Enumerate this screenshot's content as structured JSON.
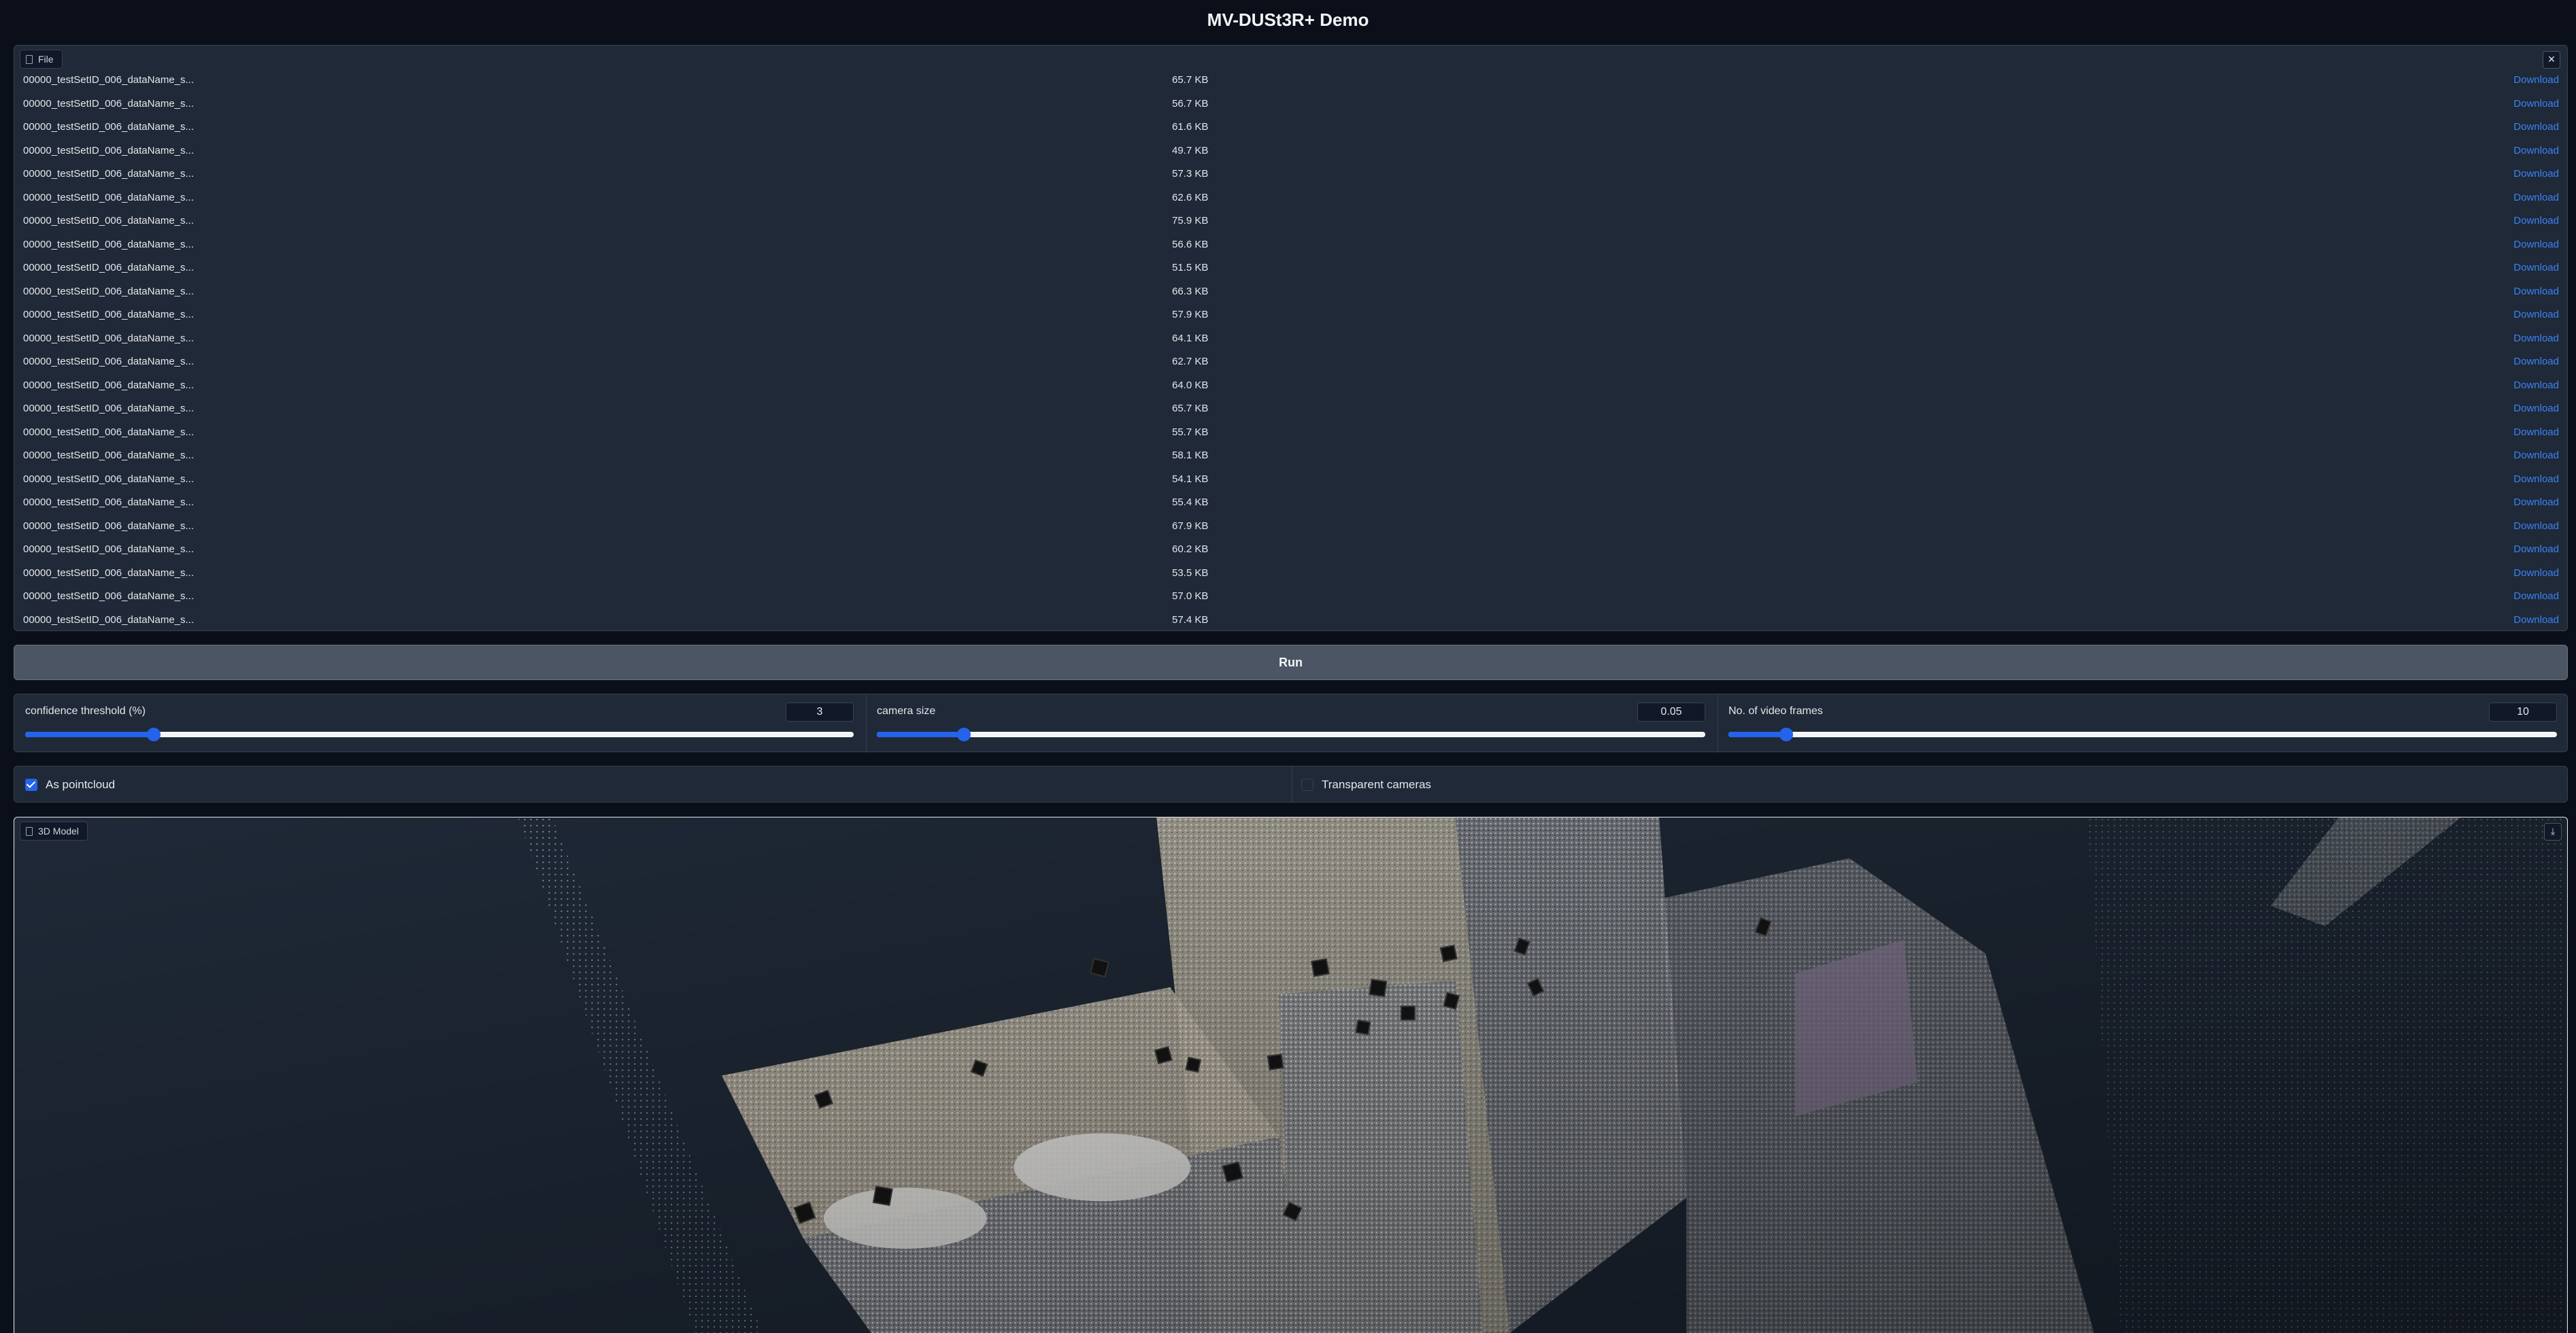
{
  "app": {
    "title": "MV-DUSt3R+ Demo"
  },
  "file_block": {
    "label": "File",
    "close_glyph": "×",
    "download_label": "Download",
    "files": [
      {
        "name": "00000_testSetID_006_dataName_s...",
        "size": "65.7 KB"
      },
      {
        "name": "00000_testSetID_006_dataName_s...",
        "size": "56.7 KB"
      },
      {
        "name": "00000_testSetID_006_dataName_s...",
        "size": "61.6 KB"
      },
      {
        "name": "00000_testSetID_006_dataName_s...",
        "size": "49.7 KB"
      },
      {
        "name": "00000_testSetID_006_dataName_s...",
        "size": "57.3 KB"
      },
      {
        "name": "00000_testSetID_006_dataName_s...",
        "size": "62.6 KB"
      },
      {
        "name": "00000_testSetID_006_dataName_s...",
        "size": "75.9 KB"
      },
      {
        "name": "00000_testSetID_006_dataName_s...",
        "size": "56.6 KB"
      },
      {
        "name": "00000_testSetID_006_dataName_s...",
        "size": "51.5 KB"
      },
      {
        "name": "00000_testSetID_006_dataName_s...",
        "size": "66.3 KB"
      },
      {
        "name": "00000_testSetID_006_dataName_s...",
        "size": "57.9 KB"
      },
      {
        "name": "00000_testSetID_006_dataName_s...",
        "size": "64.1 KB"
      },
      {
        "name": "00000_testSetID_006_dataName_s...",
        "size": "62.7 KB"
      },
      {
        "name": "00000_testSetID_006_dataName_s...",
        "size": "64.0 KB"
      },
      {
        "name": "00000_testSetID_006_dataName_s...",
        "size": "65.7 KB"
      },
      {
        "name": "00000_testSetID_006_dataName_s...",
        "size": "55.7 KB"
      },
      {
        "name": "00000_testSetID_006_dataName_s...",
        "size": "58.1 KB"
      },
      {
        "name": "00000_testSetID_006_dataName_s...",
        "size": "54.1 KB"
      },
      {
        "name": "00000_testSetID_006_dataName_s...",
        "size": "55.4 KB"
      },
      {
        "name": "00000_testSetID_006_dataName_s...",
        "size": "67.9 KB"
      },
      {
        "name": "00000_testSetID_006_dataName_s...",
        "size": "60.2 KB"
      },
      {
        "name": "00000_testSetID_006_dataName_s...",
        "size": "53.5 KB"
      },
      {
        "name": "00000_testSetID_006_dataName_s...",
        "size": "57.0 KB"
      },
      {
        "name": "00000_testSetID_006_dataName_s...",
        "size": "57.4 KB"
      }
    ]
  },
  "run_button": {
    "label": "Run"
  },
  "sliders": [
    {
      "label": "confidence threshold (%)",
      "value": "3",
      "fraction": 0.155
    },
    {
      "label": "camera size",
      "value": "0.05",
      "fraction": 0.105
    },
    {
      "label": "No. of video frames",
      "value": "10",
      "fraction": 0.07
    }
  ],
  "checkboxes": {
    "as_pointcloud": {
      "label": "As pointcloud",
      "checked": true
    },
    "transparent_cameras": {
      "label": "Transparent cameras",
      "checked": false
    }
  },
  "model_block": {
    "label": "3D Model",
    "download_icon": "download-icon"
  },
  "colors": {
    "background": "#0b0f19",
    "panel": "#1f2937",
    "border": "#374151",
    "accent": "#2563eb",
    "link": "#3b82f6",
    "button": "#4b5563"
  }
}
